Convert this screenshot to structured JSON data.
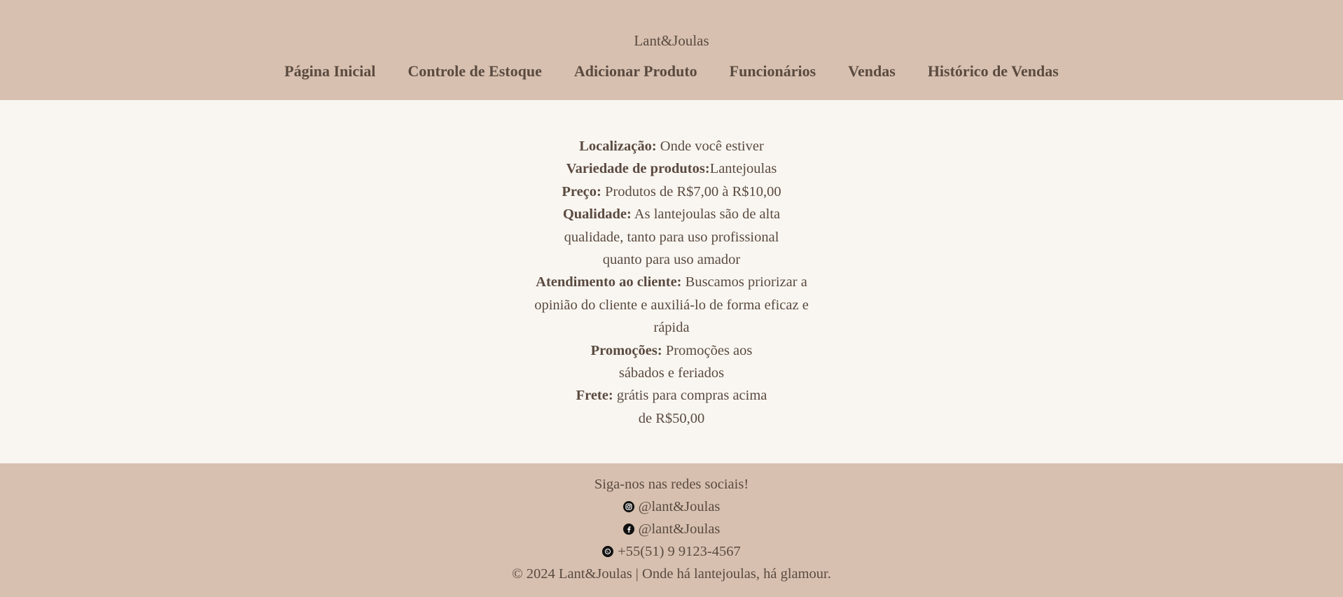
{
  "header": {
    "brand": "Lant&Joulas",
    "nav": [
      {
        "label": "Página Inicial"
      },
      {
        "label": "Controle de Estoque"
      },
      {
        "label": "Adicionar Produto"
      },
      {
        "label": "Funcionários"
      },
      {
        "label": "Vendas"
      },
      {
        "label": "Histórico de Vendas"
      }
    ]
  },
  "info": {
    "localizacao": {
      "label": "Localização:",
      "value": " Onde você estiver"
    },
    "variedade": {
      "label": "Variedade de produtos:",
      "value": "Lantejoulas"
    },
    "preco": {
      "label": "Preço:",
      "value": " Produtos de R$7,00 à R$10,00"
    },
    "qualidade": {
      "label": "Qualidade:",
      "value": " As lantejoulas são de alta qualidade, tanto para uso profissional quanto para uso amador"
    },
    "atendimento": {
      "label": "Atendimento ao cliente:",
      "value": " Buscamos priorizar a opinião do cliente e auxiliá-lo de forma eficaz e rápida"
    },
    "promocoes": {
      "label": "Promoções:",
      "value": " Promoções aos sábados e feriados"
    },
    "frete": {
      "label": "Frete:",
      "value": " grátis para compras acima de R$50,00"
    }
  },
  "footer": {
    "follow": "Siga-nos nas redes sociais!",
    "instagram": "@lant&Joulas",
    "facebook": "@lant&Joulas",
    "whatsapp": "+55(51) 9 9123-4567",
    "copyright": "© 2024 Lant&Joulas | Onde há lantejoulas, há glamour.",
    "icons": [
      "instagram-icon",
      "facebook-icon",
      "whatsapp-icon"
    ]
  }
}
